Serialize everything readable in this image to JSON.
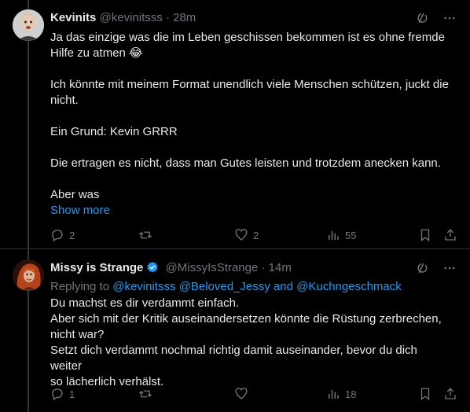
{
  "tweets": [
    {
      "author_name": "Kevinits",
      "handle": "@kevinitsss",
      "time": "28m",
      "lines": [
        "Ja das einzige was die im Leben geschissen bekommen ist es ohne fremde",
        "Hilfe zu atmen 😂",
        "",
        "Ich könnte mit meinem Format unendlich viele Menschen schützen, juckt die",
        "nicht.",
        "",
        "Ein Grund: Kevin GRRR",
        "",
        "Die ertragen es nicht, dass man Gutes leisten und trotzdem anecken kann.",
        "",
        "Aber was"
      ],
      "show_more": "Show more",
      "replies": "2",
      "retweets": "",
      "likes": "2",
      "views": "55"
    },
    {
      "author_name": "Missy is Strange",
      "handle": "@MissyIsStrange",
      "time": "14m",
      "replying_prefix": "Replying to",
      "mentions": [
        "@kevinitsss",
        "@Beloved_Jessy",
        "and",
        "@Kuchngeschmack"
      ],
      "lines": [
        "Du machst es dir verdammt einfach.",
        "Aber sich mit der Kritik auseinandersetzen könnte die Rüstung zerbrechen,",
        "nicht war?",
        "Setzt dich verdammt nochmal richtig damit auseinander, bevor du dich weiter",
        "so lächerlich verhälst."
      ],
      "replies": "1",
      "retweets": "",
      "likes": "",
      "views": "18"
    }
  ],
  "separator": "·",
  "colors": {
    "accent": "#1d9bf0",
    "muted": "#71767b",
    "text": "#e7e9ea",
    "background": "#000000"
  }
}
